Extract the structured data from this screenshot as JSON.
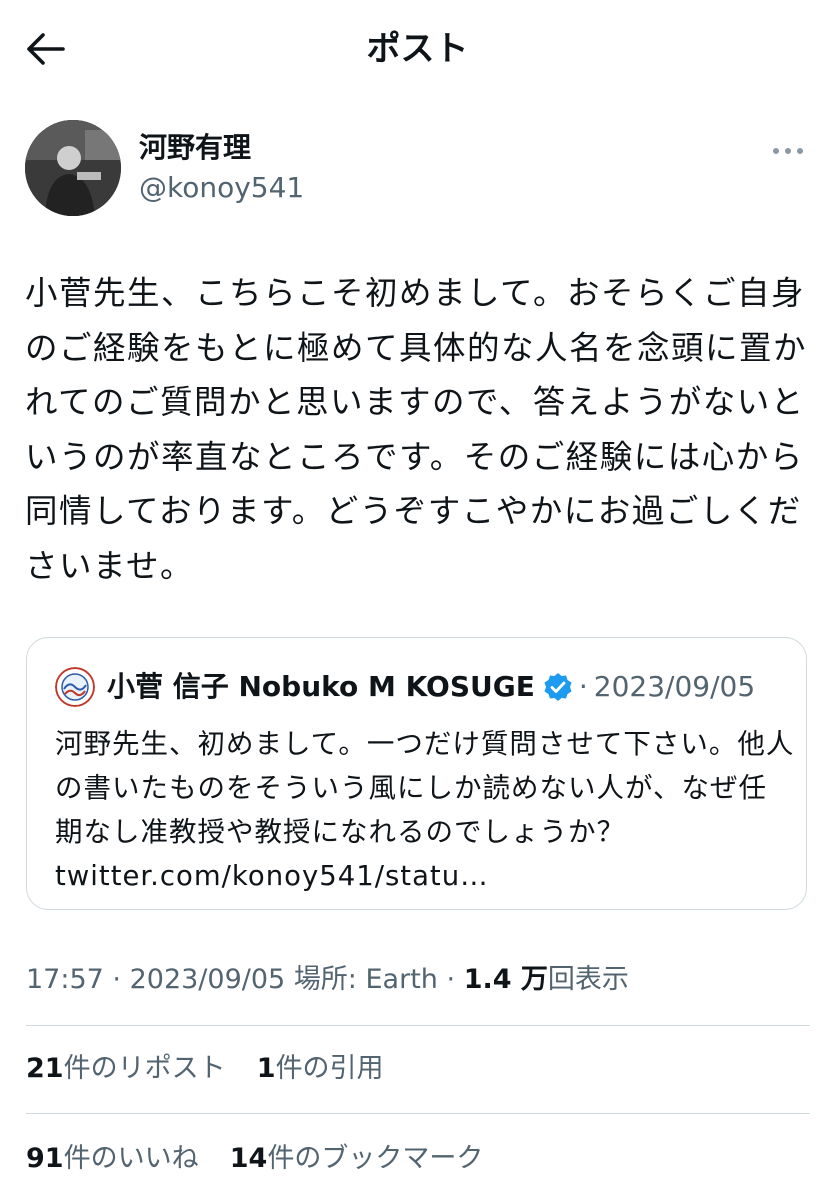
{
  "header": {
    "title": "ポスト",
    "back_icon": "arrow-left-icon"
  },
  "post": {
    "author": {
      "display_name": "河野有理",
      "handle": "@konoy541"
    },
    "more_icon": "more-horizontal-icon",
    "text": "小菅先生、こちらこそ初めまして。おそらくご自身のご経験をもとに極めて具体的な人名を念頭に置かれてのご質問かと思いますので、答えようがないというのが率直なところです。そのご経験には心から同情しております。どうぞすこやかにお過ごしくださいませ。",
    "quoted": {
      "display_name": "小菅 信子 Nobuko M KOSUGE",
      "verified_icon": "verified-badge-icon",
      "verified_color": "#1d9bf0",
      "separator": "·",
      "date": "2023/09/05",
      "text": "河野先生、初めまして。一つだけ質問させて下さい。他人の書いたものをそういう風にしか読めない人が、なぜ任期なし准教授や教授になれるのでしょうか？\ntwitter.com/konoy541/statu…"
    },
    "meta": {
      "time": "17:57",
      "separator": "·",
      "date": "2023/09/05",
      "location_label": "場所: Earth",
      "views_count": "1.4 万",
      "views_label": "回表示"
    },
    "stats": {
      "reposts_count": "21",
      "reposts_label": "件のリポスト",
      "quotes_count": "1",
      "quotes_label": "件の引用",
      "likes_count": "91",
      "likes_label": "件のいいね",
      "bookmarks_count": "14",
      "bookmarks_label": "件のブックマーク"
    }
  },
  "colors": {
    "text_primary": "#0f1419",
    "text_secondary": "#536471",
    "border": "#cfd9de"
  }
}
